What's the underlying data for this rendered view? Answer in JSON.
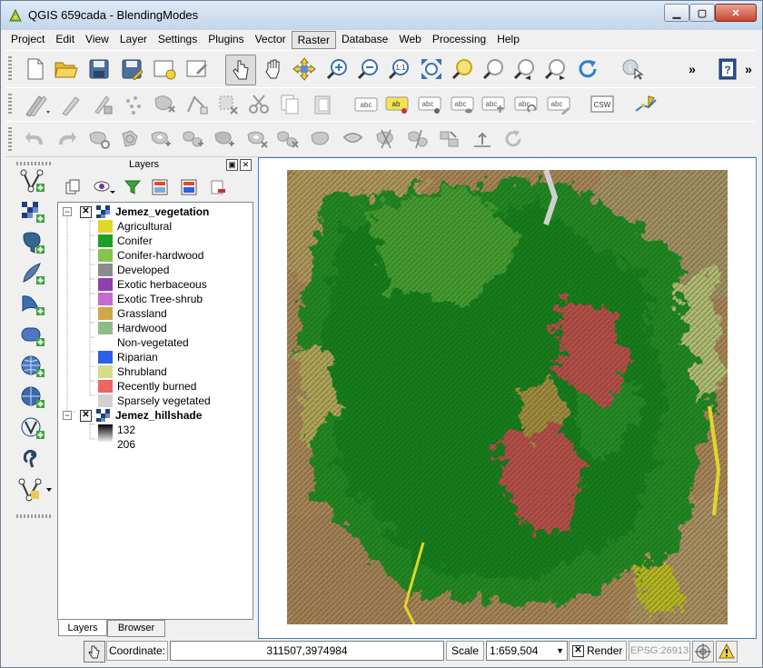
{
  "window": {
    "title": "QGIS 659cada - BlendingModes",
    "min_label": "▁",
    "max_label": "▢",
    "close_label": "✕"
  },
  "menu": [
    {
      "label": "Project"
    },
    {
      "label": "Edit"
    },
    {
      "label": "View"
    },
    {
      "label": "Layer"
    },
    {
      "label": "Settings"
    },
    {
      "label": "Plugins"
    },
    {
      "label": "Vector"
    },
    {
      "label": "Raster",
      "active": true
    },
    {
      "label": "Database"
    },
    {
      "label": "Web"
    },
    {
      "label": "Processing"
    },
    {
      "label": "Help"
    }
  ],
  "toolbar": {
    "overflow_label": "»",
    "csw_label": "CSW",
    "abc_label": "abc",
    "one_to_one_label": "1:1"
  },
  "layers_panel": {
    "title": "Layers",
    "float_label": "▣",
    "close_label": "✕",
    "layers": [
      {
        "name": "Jemez_vegetation",
        "visible": true,
        "classes": [
          {
            "label": "Agricultural",
            "color": "#e0d62c"
          },
          {
            "label": "Conifer",
            "color": "#1ba023"
          },
          {
            "label": "Conifer-hardwood",
            "color": "#86c34e"
          },
          {
            "label": "Developed",
            "color": "#8c8c8c"
          },
          {
            "label": "Exotic herbaceous",
            "color": "#8e3fb0"
          },
          {
            "label": "Exotic Tree-shrub",
            "color": "#c86ad0"
          },
          {
            "label": "Grassland",
            "color": "#cfa84a"
          },
          {
            "label": "Hardwood",
            "color": "#8ebc86"
          },
          {
            "label": "Non-vegetated",
            "color": "#ffffff"
          },
          {
            "label": "Riparian",
            "color": "#2e5fe8"
          },
          {
            "label": "Shrubland",
            "color": "#d8dc8a"
          },
          {
            "label": "Recently burned",
            "color": "#ef6464"
          },
          {
            "label": "Sparsely vegetated",
            "color": "#d2d2d2"
          }
        ]
      },
      {
        "name": "Jemez_hillshade",
        "visible": true,
        "classes": [
          {
            "label": "132",
            "color": "#000000"
          },
          {
            "label": "206",
            "color": "#ffffff"
          }
        ]
      }
    ],
    "tabs": [
      {
        "label": "Layers",
        "selected": true
      },
      {
        "label": "Browser",
        "selected": false
      }
    ]
  },
  "statusbar": {
    "coordinate_label": "Coordinate:",
    "coordinate_value": "311507,3974984",
    "scale_label": "Scale",
    "scale_value": "1:659,504",
    "render_label": "Render",
    "render_checked": true,
    "crs_label": "EPSG:26913"
  }
}
